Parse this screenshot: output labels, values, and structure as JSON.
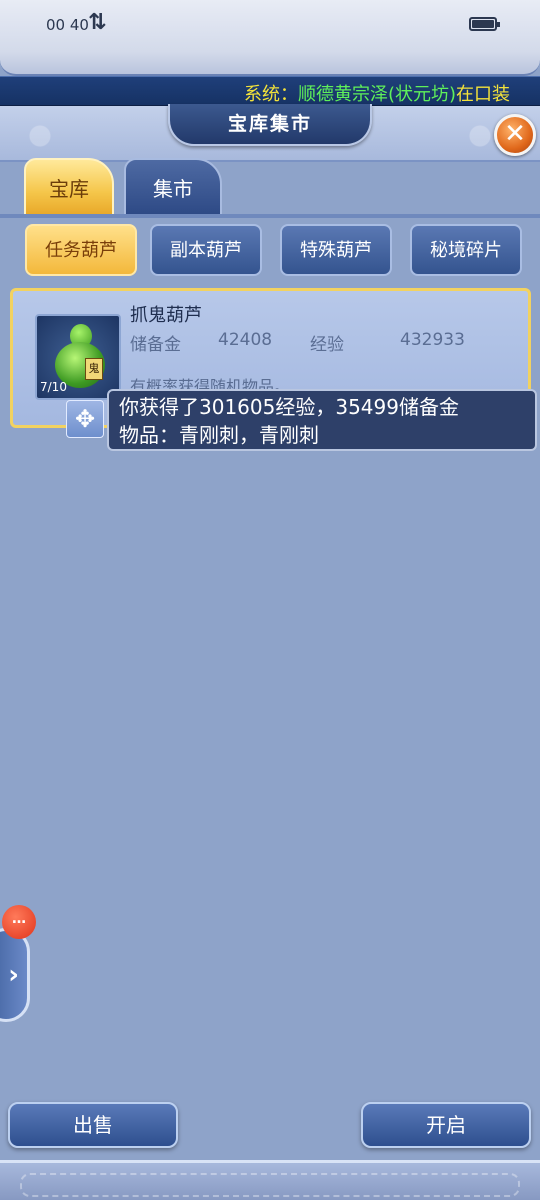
{
  "status_bar": {
    "time": "00 40",
    "network_icon": "data-transfer-icon",
    "battery_icon": "battery-icon"
  },
  "ticker": {
    "prefix": "系统：",
    "player": "顺德黄宗泽(状元坊)",
    "suffix": "在口装"
  },
  "header": {
    "title": "宝库集市",
    "close_icon": "close-icon"
  },
  "tabs": [
    {
      "label": "宝库",
      "active": true
    },
    {
      "label": "集市",
      "active": false
    }
  ],
  "subtabs": [
    {
      "label": "任务葫芦",
      "active": true
    },
    {
      "label": "副本葫芦",
      "active": false
    },
    {
      "label": "特殊葫芦",
      "active": false
    },
    {
      "label": "秘境碎片",
      "active": false
    }
  ],
  "item": {
    "name": "抓鬼葫芦",
    "count": "7/10",
    "tag": "鬼",
    "reserve_gold_label": "储备金",
    "reserve_gold_value": "42408",
    "exp_label": "经验",
    "exp_value": "432933",
    "description": "有概率获得随机物品。"
  },
  "tooltip": {
    "line1": "你获得了301605经验，35499储备金",
    "line2": "物品：青刚刺，青刚刺"
  },
  "side": {
    "badge": "…",
    "arrow": "›"
  },
  "buttons": {
    "sell": "出售",
    "open": "开启"
  },
  "colors": {
    "active_tab": "#f5c64a",
    "panel": "#8ea3c9",
    "ticker_green": "#5ff05a",
    "ticker_yellow": "#f3e23a"
  }
}
